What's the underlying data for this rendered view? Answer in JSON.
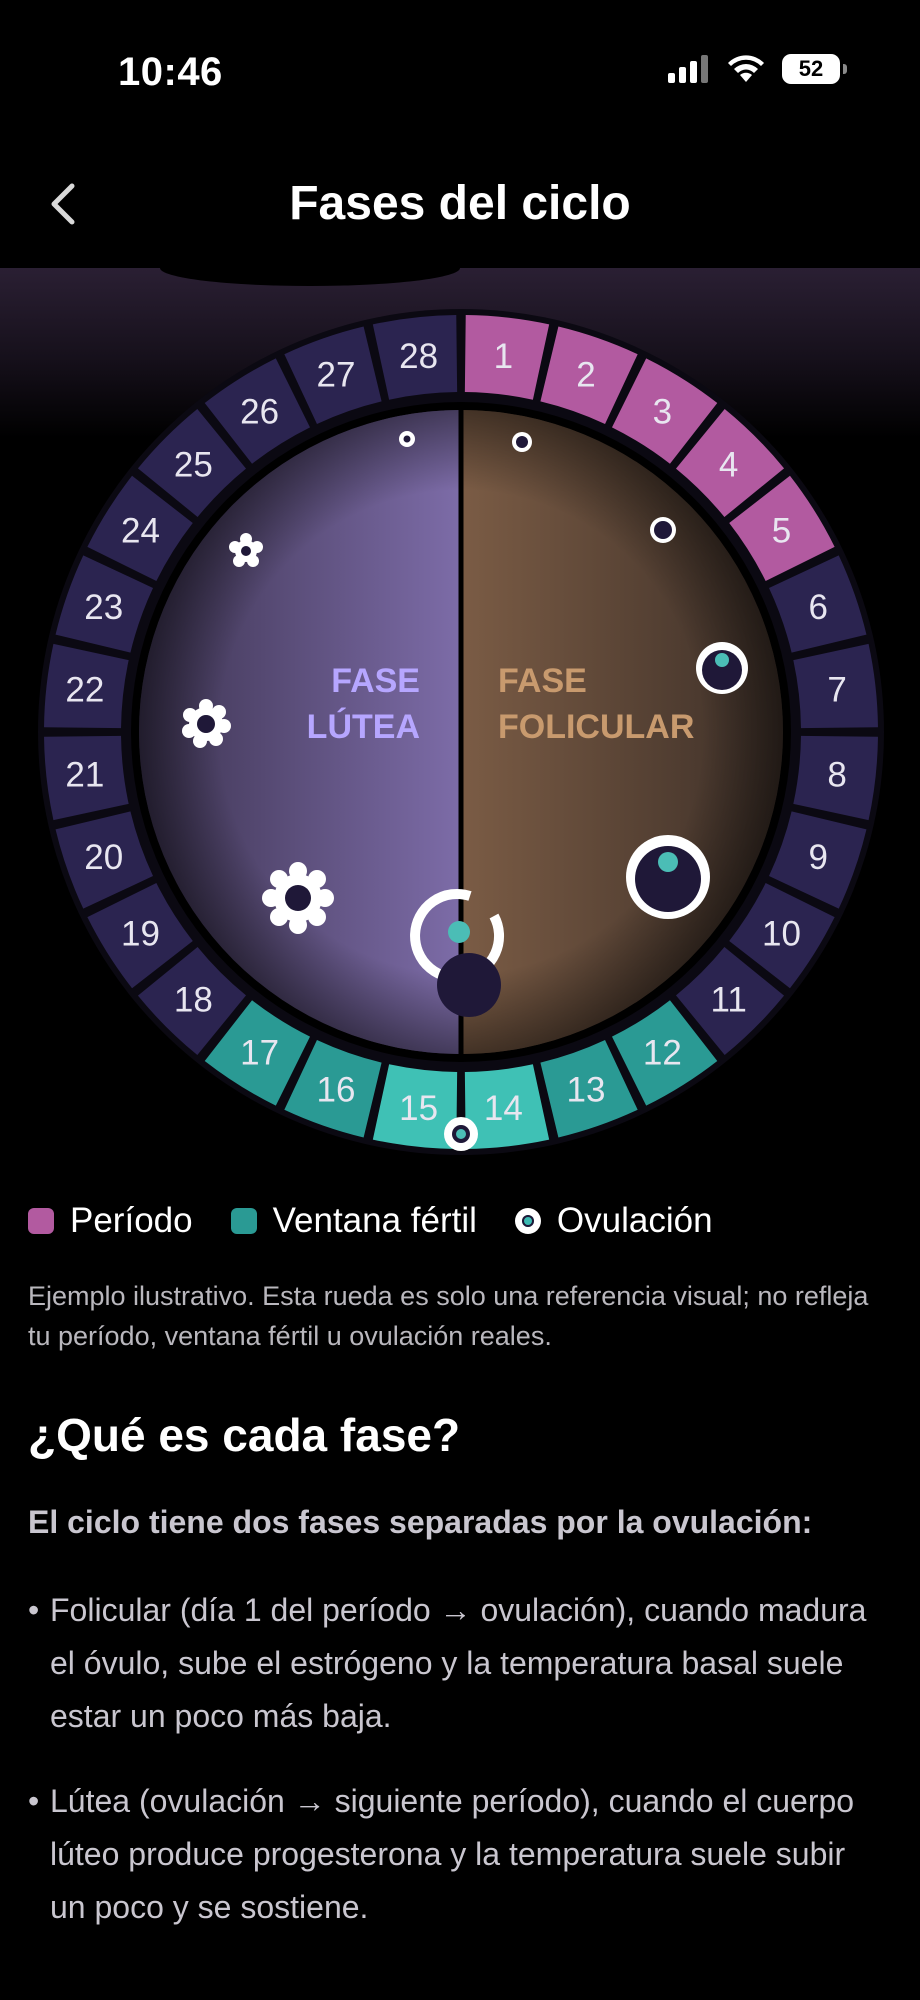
{
  "status_bar": {
    "time": "10:46",
    "battery": "52",
    "icons": [
      "signal-icon",
      "wifi-icon",
      "battery-icon"
    ]
  },
  "nav": {
    "title": "Fases del ciclo",
    "back_icon": "chevron-left-icon"
  },
  "wheel": {
    "days": [
      "1",
      "2",
      "3",
      "4",
      "5",
      "6",
      "7",
      "8",
      "9",
      "10",
      "11",
      "12",
      "13",
      "14",
      "15",
      "16",
      "17",
      "18",
      "19",
      "20",
      "21",
      "22",
      "23",
      "24",
      "25",
      "26",
      "27",
      "28"
    ],
    "period_days": [
      1,
      2,
      3,
      4,
      5
    ],
    "fertile_days": [
      12,
      13,
      14,
      15,
      16,
      17
    ],
    "ovulation_between": [
      14,
      15
    ],
    "phases": {
      "follicular_line1": "FASE",
      "follicular_line2": "FOLICULAR",
      "luteal_line1": "FASE",
      "luteal_line2": "LÚTEA"
    },
    "colors": {
      "period": "#b25aa0",
      "fertile": "#2a9a94",
      "fertile_peak": "#3fc1b5",
      "neutral": "#2b2450",
      "follicular_text": "#c89a6e",
      "luteal_text": "#b6a6ff"
    }
  },
  "legend": [
    {
      "label": "Período",
      "color": "#b25aa0",
      "kind": "swatch"
    },
    {
      "label": "Ventana fértil",
      "color": "#2a9a94",
      "kind": "swatch"
    },
    {
      "label": "Ovulación",
      "color": "#ffffff",
      "kind": "dot"
    }
  ],
  "disclaimer": "Ejemplo ilustrativo. Esta rueda es solo una referencia visual; no refleja tu período, ventana fértil u ovulación reales.",
  "section": {
    "title": "¿Qué es cada fase?",
    "intro": "El ciclo tiene dos fases separadas por la ovulación:",
    "bullets": [
      "Folicular (día 1 del período → ovulación), cuando madura el óvulo, sube el estrógeno y la temperatura basal suele estar un poco más baja.",
      "Lútea (ovulación → siguiente período), cuando el cuerpo lúteo produce progesterona y la temperatura suele subir un poco y se sostiene."
    ]
  }
}
